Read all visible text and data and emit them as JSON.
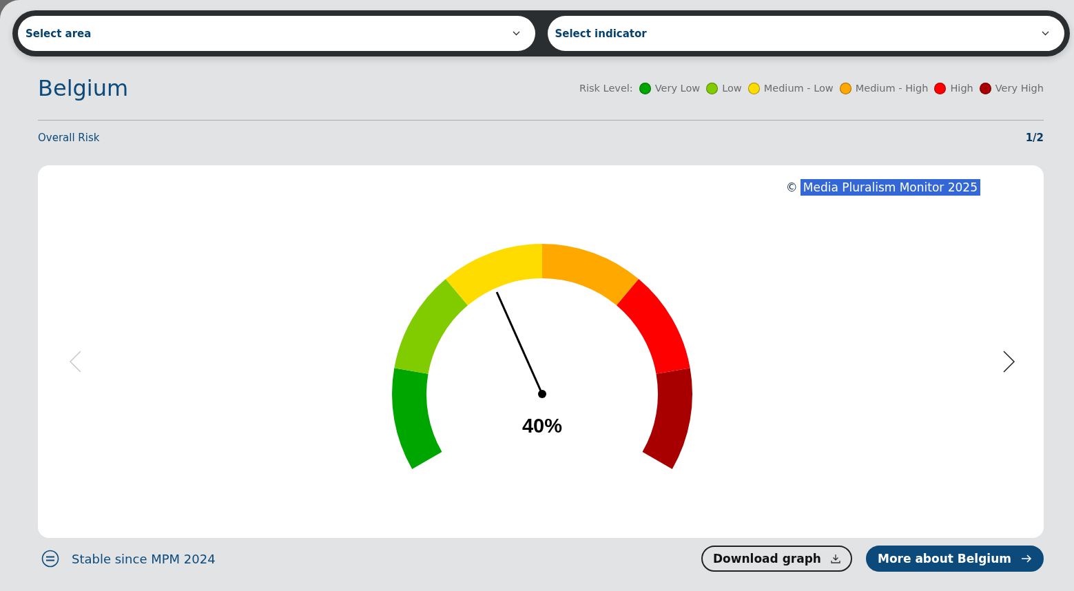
{
  "filters": [
    {
      "placeholder": "Select area"
    },
    {
      "placeholder": "Select indicator"
    }
  ],
  "title": "Belgium",
  "legend": {
    "label": "Risk Level:",
    "items": [
      {
        "label": "Very Low",
        "color": "#00a600"
      },
      {
        "label": "Low",
        "color": "#80cc00"
      },
      {
        "label": "Medium - Low",
        "color": "#ffdc00"
      },
      {
        "label": "Medium - High",
        "color": "#ffa800"
      },
      {
        "label": "High",
        "color": "#ff0000"
      },
      {
        "label": "Very High",
        "color": "#a80000"
      }
    ]
  },
  "section": {
    "label": "Overall Risk",
    "pager": "1/2"
  },
  "copyright": {
    "symbol": "©",
    "text": "Media Pluralism Monitor 2025",
    "highlighted": true
  },
  "gauge": {
    "level": 0.4,
    "reading": "40%",
    "segments": [
      {
        "color": "#00a600"
      },
      {
        "color": "#80cc00"
      },
      {
        "color": "#ffdc00"
      },
      {
        "color": "#ffa800"
      },
      {
        "color": "#ff0000"
      },
      {
        "color": "#a80000"
      }
    ]
  },
  "trend": {
    "text": "Stable since MPM 2024"
  },
  "buttons": [
    {
      "label": "Download graph",
      "kind": "outline"
    },
    {
      "label": "More about Belgium",
      "kind": "filled"
    }
  ]
}
